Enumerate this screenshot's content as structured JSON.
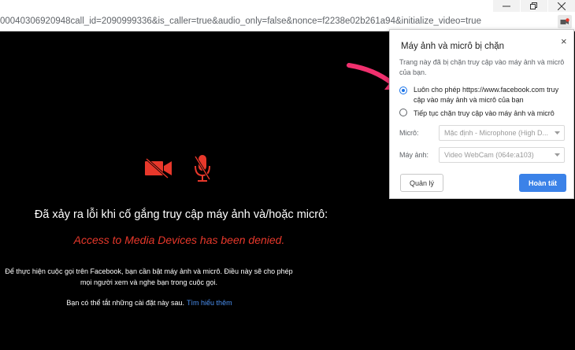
{
  "window": {
    "url": "00040306920948call_id=2090999336&is_caller=true&audio_only=false&nonce=f2238e02b261a94&initialize_video=true",
    "minimize_glyph": "min",
    "maximize_glyph": "max",
    "close_glyph": "close"
  },
  "call": {
    "error_title": "Đã xảy ra lỗi khi cố gắng truy cập máy ảnh và/hoặc micrô:",
    "error_subtitle": "Access to Media Devices has been denied.",
    "body_line1": "Để thực hiện cuộc gọi trên Facebook, bạn cần bật máy ảnh và micrô. Điều này sẽ cho phép",
    "body_line2": "mọi người xem và nghe bạn trong cuộc gọi.",
    "later_text": "Bạn có thể tắt những cài đặt này sau.",
    "learn_more": "Tìm hiểu thêm",
    "icon_color": "#e8382b"
  },
  "popup": {
    "title": "Máy ảnh và micrô bị chặn",
    "close": "×",
    "description": "Trang này đã bị chặn truy cập vào máy ảnh và micrô của bạn.",
    "option_allow": "Luôn cho phép https://www.facebook.com truy cập vào máy ảnh và micrô của bạn",
    "option_block": "Tiếp tục chặn truy cập vào máy ảnh và micrô",
    "mic_label": "Micrô:",
    "mic_value": "Mặc định - Microphone (High D...",
    "camera_label": "Máy ảnh:",
    "camera_value": "Video WebCam (064e:a103)",
    "manage_button": "Quản lý",
    "done_button": "Hoàn tất",
    "accent": "#1a73e8"
  },
  "annotation": {
    "arrow_color": "#f0306e"
  }
}
